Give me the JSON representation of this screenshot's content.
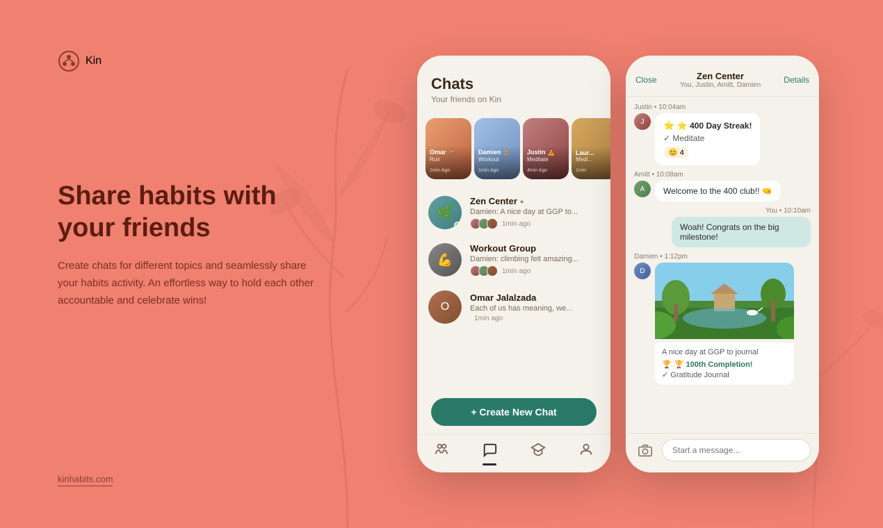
{
  "app": {
    "logo_text": "Kin",
    "footer_link": "kinhabits.com"
  },
  "hero": {
    "heading": "Share habits with your friends",
    "subtext": "Create chats for different topics and seamlessly share your habits activity. An effortless way to hold each other accountable and celebrate wins!"
  },
  "chats_screen": {
    "title": "Chats",
    "subtitle": "Your friends on Kin",
    "stories": [
      {
        "name": "Omar 🏃",
        "habit": "Run",
        "time": "1min Ago",
        "color": "story-omar"
      },
      {
        "name": "Damien 🏋",
        "habit": "Workout",
        "time": "1min Ago",
        "color": "story-damien"
      },
      {
        "name": "Justin 🧘",
        "habit": "Meditate",
        "time": "4min Ago",
        "color": "story-justin"
      },
      {
        "name": "Laur...",
        "habit": "Medi...",
        "time": "1min",
        "color": "story-laura"
      }
    ],
    "chats": [
      {
        "name": "Zen Center",
        "online": true,
        "preview": "Damien: A nice day at GGP to...",
        "time": "1min ago"
      },
      {
        "name": "Workout Group",
        "online": false,
        "preview": "Damien: climbing felt amazing...",
        "time": "1min ago"
      },
      {
        "name": "Omar Jalalzada",
        "online": false,
        "preview": "Each of us has meaning, we...",
        "time": "1min ago"
      }
    ],
    "create_btn": "+ Create New Chat",
    "nav_items": [
      "people",
      "chat",
      "learn",
      "profile"
    ]
  },
  "chat_detail_screen": {
    "close_label": "Close",
    "group_name": "Zen Center",
    "members": "You, Justin, Amitt, Damien",
    "details_label": "Details",
    "messages": [
      {
        "sender": "Justin",
        "time": "10:04am",
        "type": "habit_card",
        "streak_label": "⭐ 400 Day Streak!",
        "habit_name": "✓ Meditate",
        "reaction": "😊 4"
      },
      {
        "sender": "Amitt",
        "time": "10:08am",
        "type": "text",
        "text": "Welcome to the 400 club!! 🤜",
        "mine": false
      },
      {
        "sender": "You",
        "time": "10:10am",
        "type": "text",
        "text": "Woah! Congrats on the big milestone!",
        "mine": true
      },
      {
        "sender": "Damien",
        "time": "1:12pm",
        "type": "photo_habit",
        "caption": "A nice day at GGP to journal",
        "habit_label": "🏆 100th Completion!",
        "habit_sub": "✓ Gratitude Journal"
      }
    ],
    "input_placeholder": "Start a message..."
  }
}
